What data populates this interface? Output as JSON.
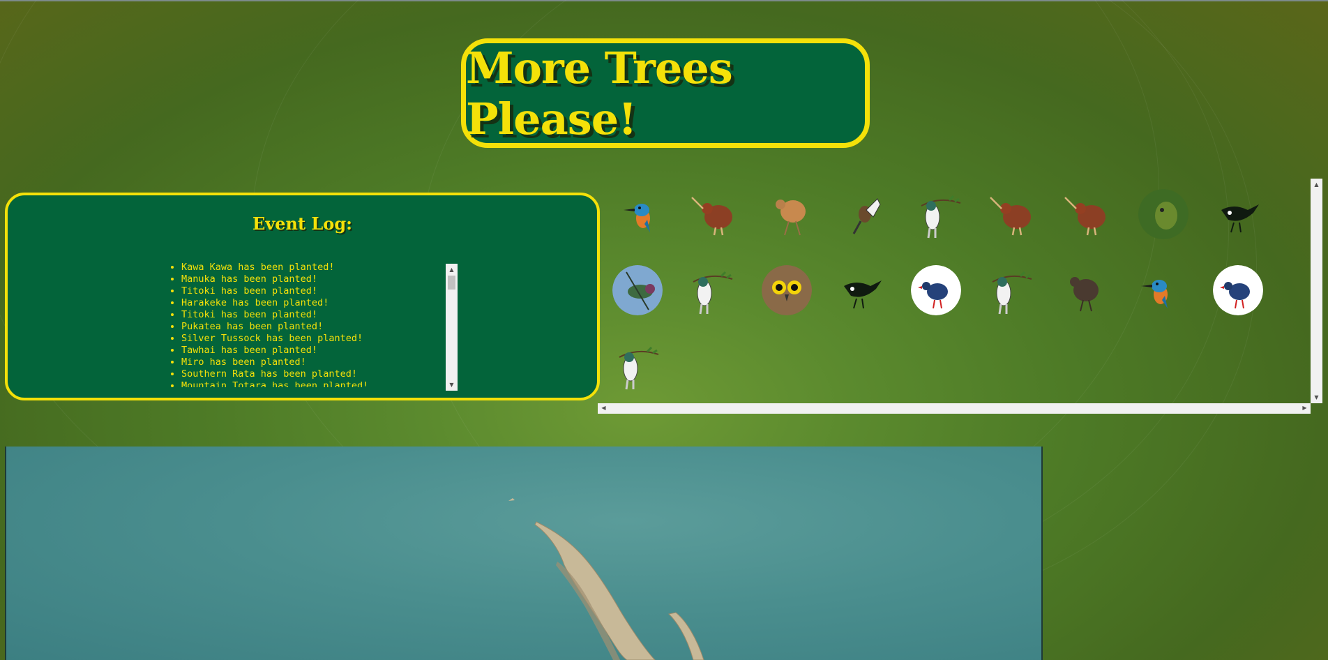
{
  "header": {
    "title": "More Trees Please!"
  },
  "event_log": {
    "title": "Event Log:",
    "entries": [
      "Kawa Kawa has been planted!",
      "Manuka has been planted!",
      "Titoki has been planted!",
      "Harakeke has been planted!",
      "Titoki has been planted!",
      "Pukatea has been planted!",
      "Silver Tussock has been planted!",
      "Tawhai has been planted!",
      "Miro has been planted!",
      "Southern Rata has been planted!",
      "Mountain Totara has been planted!"
    ]
  },
  "birds": [
    "kingfisher-icon",
    "kiwi-icon",
    "weka-icon",
    "fantail-icon",
    "kereru-icon",
    "kiwi-icon",
    "kiwi-icon",
    "kakapo-icon",
    "tui-icon",
    "bellbird-icon",
    "kereru-icon",
    "morepork-icon",
    "tui-icon",
    "pukeko-icon",
    "kereru-icon",
    "weka-icon",
    "kingfisher-icon",
    "pukeko-icon",
    "kereru-icon"
  ],
  "colors": {
    "accent": "#f4e109",
    "panel": "#03643a",
    "background": "#4d7a26"
  }
}
